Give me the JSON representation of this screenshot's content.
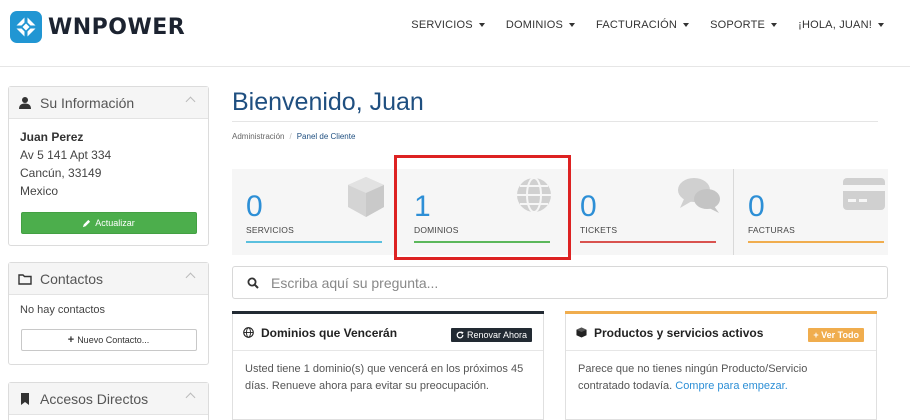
{
  "brand": {
    "name": "WNPOWER",
    "color": "#2196d3",
    "logo_icon": "wnpower-logo-icon"
  },
  "nav": {
    "items": [
      {
        "label": "SERVICIOS"
      },
      {
        "label": "DOMINIOS"
      },
      {
        "label": "FACTURACIÓN"
      },
      {
        "label": "SOPORTE"
      },
      {
        "label": "¡HOLA, JUAN!"
      }
    ]
  },
  "sidebar": {
    "info": {
      "title": "Su Información",
      "icon": "user-icon",
      "name": "Juan Perez",
      "address_lines": [
        "Av 5 141 Apt 334",
        "Cancún, 33149",
        "Mexico"
      ],
      "button_label": "Actualizar",
      "button_icon": "pencil-icon"
    },
    "contacts": {
      "title": "Contactos",
      "icon": "folder-icon",
      "empty_text": "No hay contactos",
      "button_label": "Nuevo Contacto...",
      "button_icon": "plus-icon"
    },
    "shortcuts": {
      "title": "Accesos Directos",
      "icon": "bookmark-icon"
    }
  },
  "main": {
    "title": "Bienvenido, Juan",
    "breadcrumb": [
      "Administración",
      "Panel de Cliente"
    ],
    "stats": [
      {
        "value": "0",
        "label": "SERVICIOS",
        "icon": "cube-icon",
        "color": "#5bc0de"
      },
      {
        "value": "1",
        "label": "DOMINIOS",
        "icon": "globe-icon",
        "color": "#5cb85c"
      },
      {
        "value": "0",
        "label": "TICKETS",
        "icon": "comments-icon",
        "color": "#d9534f"
      },
      {
        "value": "0",
        "label": "FACTURAS",
        "icon": "credit-card-icon",
        "color": "#f0ad4e"
      }
    ],
    "search_placeholder": "Escriba aquí su pregunta...",
    "cards": [
      {
        "title": "Dominios que Vencerán",
        "icon": "globe-icon",
        "accent": "#222a33",
        "button_label": "Renovar Ahora",
        "button_icon": "refresh-icon",
        "text": "Usted tiene 1 dominio(s) que vencerá en los próximos 45 días. Renueve ahora para evitar su preocupación."
      },
      {
        "title": "Productos y servicios activos",
        "icon": "cube-icon",
        "accent": "#f0ad4e",
        "button_label": "+ Ver Todo",
        "text_before_link": "Parece que no tienes ningún Producto/Servicio contratado todavía.",
        "link_text": "Compre para empezar."
      }
    ]
  }
}
